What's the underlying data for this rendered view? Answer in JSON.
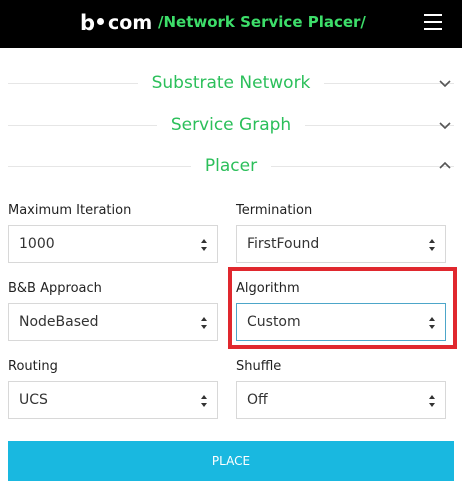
{
  "header": {
    "logo_b": "b",
    "logo_com": "com",
    "title": "/Network Service Placer/",
    "background": "#000000",
    "title_color": "#3dde6a"
  },
  "sections": {
    "substrate": {
      "label": "Substrate Network",
      "state": "collapsed",
      "icon": "chevron-down-icon"
    },
    "service": {
      "label": "Service Graph",
      "state": "collapsed",
      "icon": "chevron-down-icon"
    },
    "placer": {
      "label": "Placer",
      "state": "expanded",
      "icon": "chevron-up-icon"
    }
  },
  "form": {
    "max_iteration": {
      "label": "Maximum Iteration",
      "value": "1000"
    },
    "termination": {
      "label": "Termination",
      "value": "FirstFound"
    },
    "bb_approach": {
      "label": "B&B Approach",
      "value": "NodeBased"
    },
    "algorithm": {
      "label": "Algorithm",
      "value": "Custom"
    },
    "routing": {
      "label": "Routing",
      "value": "UCS"
    },
    "shuffle": {
      "label": "Shuffle",
      "value": "Off"
    }
  },
  "actions": {
    "place_label": "PLACE"
  },
  "colors": {
    "accent_green": "#2bbf5a",
    "button_blue": "#19b8e0",
    "highlight_red": "#e0282e"
  }
}
